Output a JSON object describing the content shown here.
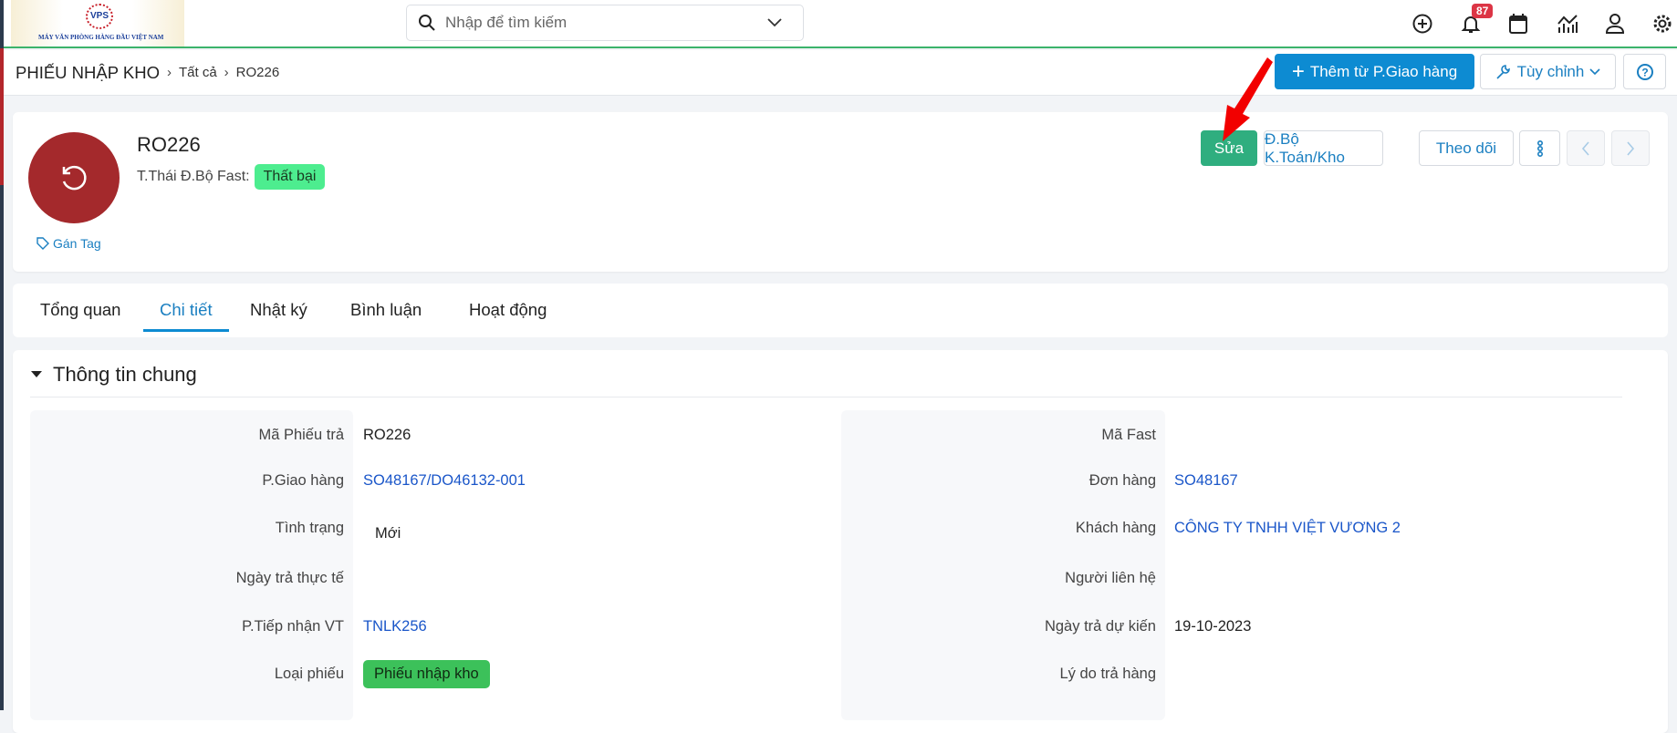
{
  "topbar": {
    "logo_text": "MÁY VĂN PHÒNG HÀNG ĐẦU VIỆT NAM",
    "logo_mark": "VPS",
    "search_placeholder": "Nhập để tìm kiếm",
    "notification_count": "87",
    "icons": [
      "plus-circle-icon",
      "bell-icon",
      "calendar-icon",
      "chart-icon",
      "user-icon",
      "gear-icon"
    ]
  },
  "breadcrumb": {
    "module": "PHIẾU NHẬP KHO",
    "items": [
      "Tất cả",
      "RO226"
    ]
  },
  "toolbar": {
    "add_from_delivery": "Thêm từ P.Giao hàng",
    "customize": "Tùy chỉnh"
  },
  "record": {
    "title": "RO226",
    "fast_sync_label": "T.Thái Đ.Bộ Fast:",
    "fast_sync_status": "Thất bại",
    "tag_label": "Gán Tag",
    "avatar_color": "#a4292c",
    "status_color": "#4ded8f"
  },
  "actions": {
    "edit": "Sửa",
    "sync": "Đ.Bộ K.Toán/Kho",
    "follow": "Theo dõi"
  },
  "tabs": [
    {
      "label": "Tổng quan"
    },
    {
      "label": "Chi tiết",
      "active": true
    },
    {
      "label": "Nhật ký"
    },
    {
      "label": "Bình luận"
    },
    {
      "label": "Hoạt động"
    }
  ],
  "section": {
    "title": "Thông tin chung"
  },
  "fields_left": [
    {
      "label": "Mã Phiếu trả",
      "value": "RO226"
    },
    {
      "label": "P.Giao hàng",
      "value": "SO48167/DO46132-001",
      "link": true
    },
    {
      "label": "Tình trạng",
      "value": "Mới"
    },
    {
      "label": "Ngày trả thực tế",
      "value": ""
    },
    {
      "label": "P.Tiếp nhận VT",
      "value": "TNLK256",
      "link": true
    },
    {
      "label": "Loại phiếu",
      "value": "Phiếu nhập kho",
      "badge_color": "#3cc15a"
    }
  ],
  "fields_right": [
    {
      "label": "Mã Fast",
      "value": ""
    },
    {
      "label": "Đơn hàng",
      "value": "SO48167",
      "link": true
    },
    {
      "label": "Khách hàng",
      "value": "CÔNG TY TNHH VIỆT VƯƠNG 2",
      "link": true
    },
    {
      "label": "Người liên hệ",
      "value": ""
    },
    {
      "label": "Ngày trả dự kiến",
      "value": "19-10-2023"
    },
    {
      "label": "Lý do trả hàng",
      "value": ""
    }
  ]
}
